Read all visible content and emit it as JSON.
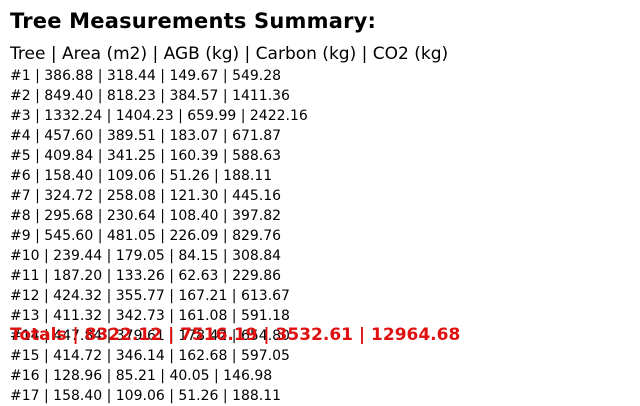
{
  "title": "Tree Measurements Summary:",
  "header": "Tree | Area (m2) | AGB (kg) | Carbon (kg) | CO2 (kg)",
  "rows": [
    "#1 | 386.88 | 318.44 | 149.67 | 549.28",
    "#2 | 849.40 | 818.23 | 384.57 | 1411.36",
    "#3 | 1332.24 | 1404.23 | 659.99 | 2422.16",
    "#4 | 457.60 | 389.51 | 183.07 | 671.87",
    "#5 | 409.84 | 341.25 | 160.39 | 588.63",
    "#6 | 158.40 | 109.06 | 51.26 | 188.11",
    "#7 | 324.72 | 258.08 | 121.30 | 445.16",
    "#8 | 295.68 | 230.64 | 108.40 | 397.82",
    "#9 | 545.60 | 481.05 | 226.09 | 829.76",
    "#10 | 239.44 | 179.05 | 84.15 | 308.84",
    "#11 | 187.20 | 133.26 | 62.63 | 229.86",
    "#12 | 424.32 | 355.77 | 167.21 | 613.67",
    "#13 | 411.32 | 342.73 | 161.08 | 591.18",
    "#14 | 447.84 | 379.61 | 178.42 | 654.80",
    "#15 | 414.72 | 346.14 | 162.68 | 597.05",
    "#16 | 128.96 | 85.21 | 40.05 | 146.98",
    "#17 | 158.40 | 109.06 | 51.26 | 188.11"
  ],
  "totals": "Totals | 8322.12 | 7516.19 | 3532.61 | 12964.68",
  "colors": {
    "text": "#000000",
    "totals": "#e01010",
    "background": "#ffffff"
  }
}
